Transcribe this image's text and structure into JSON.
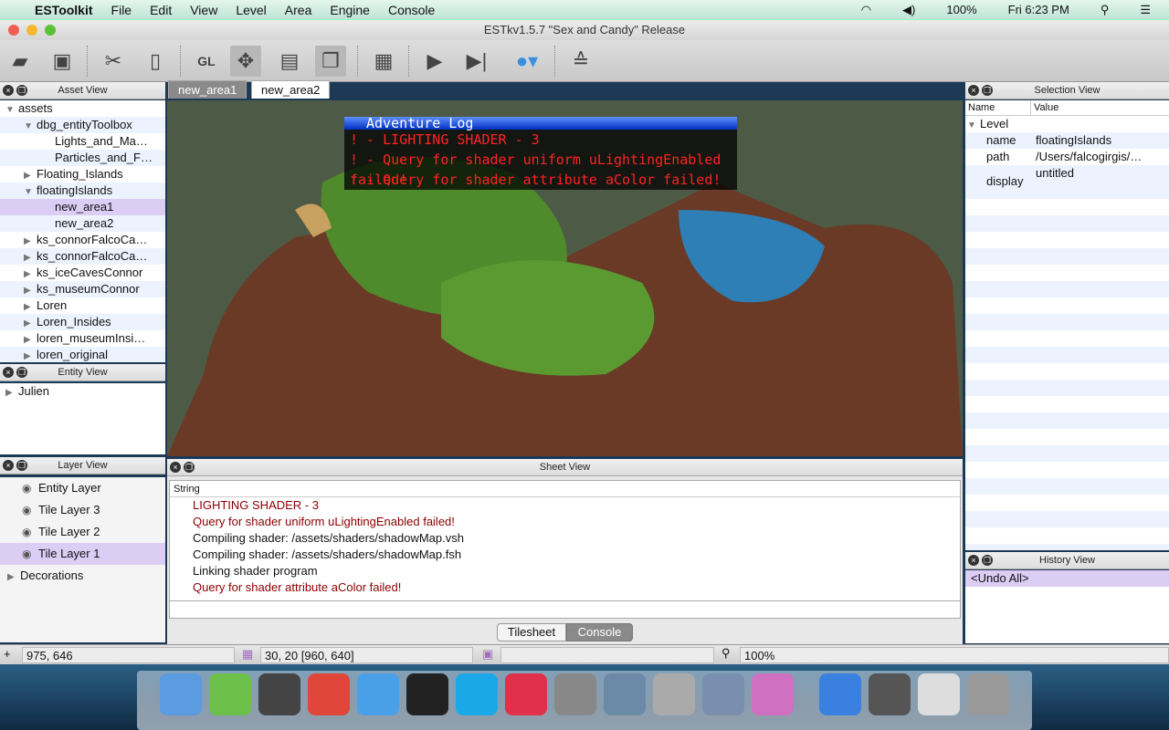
{
  "menubar": {
    "app": "ESToolkit",
    "items": [
      "File",
      "Edit",
      "View",
      "Level",
      "Area",
      "Engine",
      "Console"
    ],
    "battery": "100%",
    "clock": "Fri 6:23 PM"
  },
  "window": {
    "title": "ESTkv1.5.7 \"Sex and Candy\" Release"
  },
  "toolbar": {
    "icons": [
      "open-folder-icon",
      "save-icon",
      "cut-icon",
      "paste-icon",
      "opengl-icon",
      "move-icon",
      "tileset-icon",
      "window-icon",
      "console-window-icon",
      "play-icon",
      "step-icon",
      "apple-icon",
      "stack-icon"
    ]
  },
  "asset_view": {
    "title": "Asset View",
    "items": [
      {
        "label": "assets",
        "level": 0,
        "tri": "▼"
      },
      {
        "label": "dbg_entityToolbox",
        "level": 1,
        "tri": "▼"
      },
      {
        "label": "Lights_and_Ma…",
        "level": 2,
        "tri": ""
      },
      {
        "label": "Particles_and_F…",
        "level": 2,
        "tri": ""
      },
      {
        "label": "Floating_Islands",
        "level": 1,
        "tri": "▶"
      },
      {
        "label": "floatingIslands",
        "level": 1,
        "tri": "▼"
      },
      {
        "label": "new_area1",
        "level": 2,
        "tri": "",
        "selected": true
      },
      {
        "label": "new_area2",
        "level": 2,
        "tri": ""
      },
      {
        "label": "ks_connorFalcoCa…",
        "level": 1,
        "tri": "▶"
      },
      {
        "label": "ks_connorFalcoCa…",
        "level": 1,
        "tri": "▶"
      },
      {
        "label": "ks_iceCavesConnor",
        "level": 1,
        "tri": "▶"
      },
      {
        "label": "ks_museumConnor",
        "level": 1,
        "tri": "▶"
      },
      {
        "label": "Loren",
        "level": 1,
        "tri": "▶"
      },
      {
        "label": "Loren_Insides",
        "level": 1,
        "tri": "▶"
      },
      {
        "label": "loren_museumInsi…",
        "level": 1,
        "tri": "▶"
      },
      {
        "label": "loren_original",
        "level": 1,
        "tri": "▶"
      }
    ]
  },
  "entity_view": {
    "title": "Entity View",
    "items": [
      "Julien"
    ]
  },
  "layer_view": {
    "title": "Layer View",
    "layers": [
      "Entity Layer",
      "Tile Layer 3",
      "Tile Layer 2",
      "Tile Layer 1"
    ],
    "selected": "Tile Layer 1",
    "groups": [
      "Decorations"
    ]
  },
  "editor": {
    "tabs": [
      "new_area1",
      "new_area2"
    ],
    "active_tab": "new_area1"
  },
  "adventure_log": {
    "title": "Adventure Log",
    "lines": [
      "! - LIGHTING SHADER - 3",
      "! - Query for shader uniform uLightingEnabled failed!",
      "! - Query for shader attribute aColor failed!"
    ]
  },
  "sheet_view": {
    "title": "Sheet View",
    "column": "String",
    "lines": [
      {
        "text": "LIGHTING SHADER - 3",
        "error": true
      },
      {
        "text": "Query for shader uniform uLightingEnabled failed!",
        "error": true
      },
      {
        "text": "Compiling shader: /assets/shaders/shadowMap.vsh",
        "error": false
      },
      {
        "text": "Compiling shader: /assets/shaders/shadowMap.fsh",
        "error": false
      },
      {
        "text": "Linking shader program",
        "error": false
      },
      {
        "text": "Query for shader attribute aColor failed!",
        "error": true
      }
    ],
    "tabs": [
      "Tilesheet",
      "Console"
    ],
    "active_tab": "Console"
  },
  "selection_view": {
    "title": "Selection View",
    "columns": [
      "Name",
      "Value"
    ],
    "group": "Level",
    "props": [
      {
        "name": "name",
        "value": "floatingIslands"
      },
      {
        "name": "path",
        "value": "/Users/falcogirgis/…"
      },
      {
        "name": "display",
        "value": "untitled"
      }
    ]
  },
  "history_view": {
    "title": "History View",
    "items": [
      "<Undo All>"
    ]
  },
  "status": {
    "cursor": "975, 646",
    "tiles": "30, 20 [960, 640]",
    "layer": "",
    "zoom": "100%"
  },
  "dock": {
    "apps": [
      "finder",
      "qt-creator",
      "sublime-text",
      "chrome",
      "messages",
      "terminal",
      "skype",
      "itunes",
      "system-preferences",
      "iphoto",
      "image-capture",
      "preview",
      "game-sprite",
      "app-store",
      "screen",
      "launcher",
      "trash"
    ]
  }
}
